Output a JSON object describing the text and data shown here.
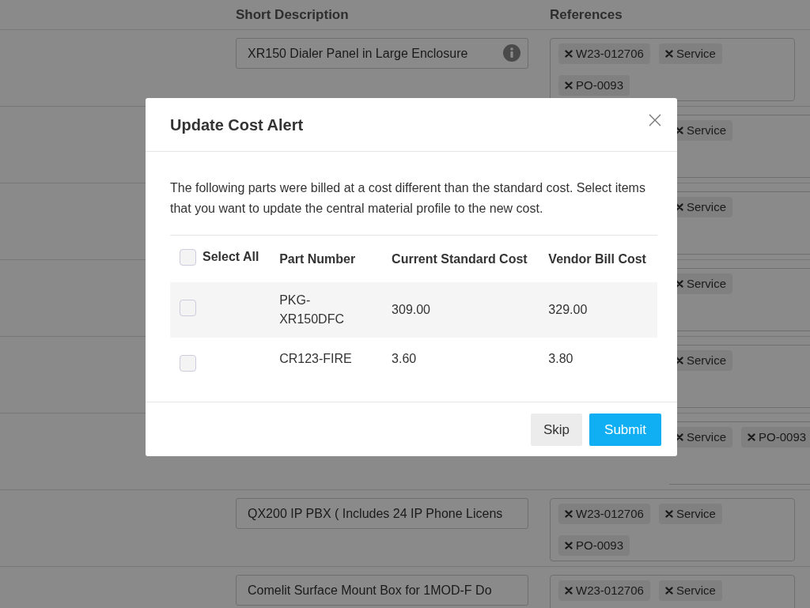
{
  "page": {
    "columns": [
      "Short Description",
      "References"
    ],
    "rows": [
      {
        "kind": "full",
        "description": "XR150 Dialer Panel in Large Enclosure",
        "info": true,
        "references": [
          "W23-012706",
          "Service",
          "PO-0093"
        ]
      },
      {
        "kind": "covered",
        "references": [
          "Service"
        ]
      },
      {
        "kind": "covered",
        "references": [
          "Service"
        ]
      },
      {
        "kind": "covered",
        "references": [
          "Service"
        ]
      },
      {
        "kind": "covered",
        "references": [
          "Service"
        ]
      },
      {
        "kind": "covered",
        "references": [
          "Service",
          "PO-0093"
        ]
      },
      {
        "kind": "full",
        "description": "QX200 IP PBX ( Includes 24 IP Phone Licens",
        "info": false,
        "references": [
          "W23-012706",
          "Service",
          "PO-0093"
        ]
      },
      {
        "kind": "full",
        "description": "Comelit Surface Mount Box for 1MOD-F Do",
        "info": false,
        "references": [
          "W23-012706",
          "Service"
        ]
      }
    ]
  },
  "modal": {
    "title": "Update Cost Alert",
    "message": "The following parts were billed at a cost different than the standard cost. Select items that you want to update the central material profile to the new cost.",
    "select_all": {
      "label": "Select All",
      "checked": false
    },
    "columns": [
      "Part Number",
      "Current Standard Cost",
      "Vendor Bill Cost"
    ],
    "rows": [
      {
        "part_number": "PKG-XR150DFC",
        "current_cost": "309.00",
        "vendor_cost": "329.00",
        "checked": false
      },
      {
        "part_number": "CR123-FIRE",
        "current_cost": "3.60",
        "vendor_cost": "3.80",
        "checked": false
      }
    ],
    "buttons": [
      {
        "label": "Skip",
        "kind": "secondary"
      },
      {
        "label": "Submit",
        "kind": "primary"
      }
    ]
  }
}
